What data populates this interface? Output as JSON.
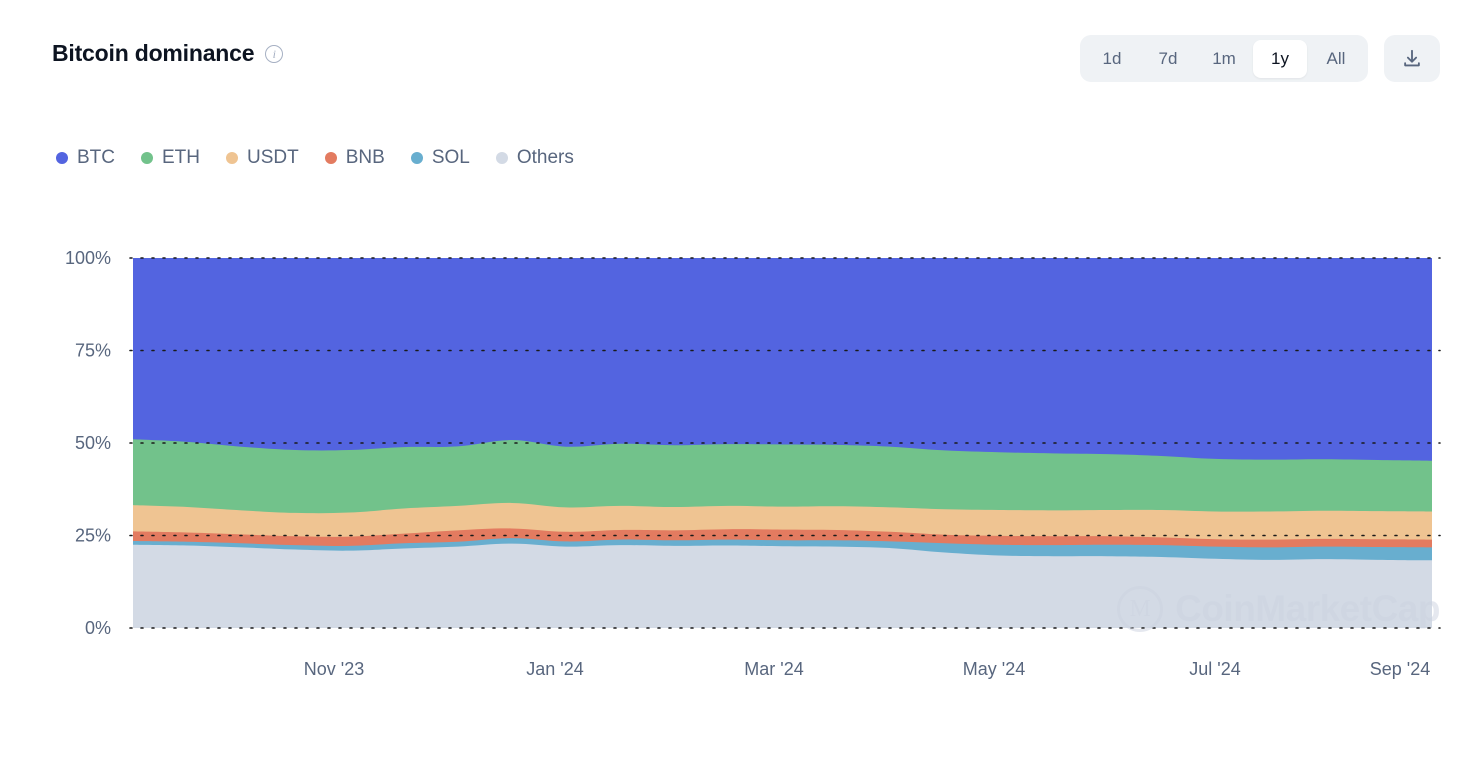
{
  "header": {
    "title": "Bitcoin dominance",
    "info_icon": "info-icon",
    "download_icon": "download-icon"
  },
  "range_selector": {
    "options": [
      "1d",
      "7d",
      "1m",
      "1y",
      "All"
    ],
    "selected": "1y"
  },
  "watermark": {
    "text": "CoinMarketCap",
    "mark": "M"
  },
  "chart_data": {
    "type": "area",
    "stacked": true,
    "normalized": true,
    "title": "Bitcoin dominance",
    "xlabel": "",
    "ylabel": "",
    "ylim": [
      0,
      100
    ],
    "grid": true,
    "legend_position": "top-left",
    "ytick_labels": [
      "0%",
      "25%",
      "50%",
      "75%",
      "100%"
    ],
    "ytick_values": [
      0,
      25,
      50,
      75,
      100
    ],
    "xtick_labels": [
      "Nov '23",
      "Jan '24",
      "Mar '24",
      "May '24",
      "Jul '24",
      "Sep '24"
    ],
    "colors": {
      "BTC": "#5364e0",
      "ETH": "#72c28b",
      "USDT": "#efc492",
      "BNB": "#e37b60",
      "SOL": "#68aecf",
      "Others": "#d3dae5"
    },
    "x": [
      "Sep '23",
      "Oct '23",
      "Oct '23",
      "Nov '23",
      "Nov '23",
      "Dec '23",
      "Dec '23",
      "Jan '24",
      "Jan '24",
      "Feb '24",
      "Feb '24",
      "Mar '24",
      "Mar '24",
      "Apr '24",
      "Apr '24",
      "May '24",
      "May '24",
      "Jun '24",
      "Jun '24",
      "Jul '24",
      "Jul '24",
      "Aug '24",
      "Aug '24",
      "Sep '24",
      "Sep '24"
    ],
    "series": [
      {
        "name": "Others",
        "values": [
          22.5,
          22.3,
          21.8,
          21.2,
          20.9,
          21.5,
          22.0,
          22.8,
          22.0,
          22.4,
          22.2,
          22.3,
          22.1,
          22.0,
          21.6,
          20.4,
          19.6,
          19.4,
          19.4,
          19.2,
          18.7,
          18.4,
          18.6,
          18.4,
          18.3
        ]
      },
      {
        "name": "SOL",
        "values": [
          1.0,
          1.0,
          1.1,
          1.2,
          1.3,
          1.4,
          1.3,
          1.5,
          1.4,
          1.5,
          1.5,
          1.6,
          1.6,
          1.7,
          1.8,
          2.5,
          2.9,
          3.0,
          3.1,
          3.2,
          3.3,
          3.4,
          3.4,
          3.5,
          3.5
        ]
      },
      {
        "name": "BNB",
        "values": [
          2.6,
          2.5,
          2.4,
          2.4,
          2.5,
          2.6,
          3.1,
          2.6,
          2.6,
          2.6,
          2.7,
          2.8,
          2.9,
          2.8,
          2.6,
          2.3,
          2.4,
          2.4,
          2.3,
          2.1,
          2.0,
          2.1,
          2.1,
          2.1,
          2.1
        ]
      },
      {
        "name": "USDT",
        "values": [
          7.1,
          6.9,
          6.5,
          6.3,
          6.5,
          6.8,
          6.6,
          6.9,
          6.6,
          6.5,
          6.3,
          6.3,
          6.2,
          6.4,
          6.6,
          6.9,
          7.0,
          7.0,
          7.1,
          7.4,
          7.5,
          7.6,
          7.6,
          7.6,
          7.6
        ]
      },
      {
        "name": "ETH",
        "values": [
          17.8,
          17.6,
          17.2,
          17.0,
          16.9,
          16.6,
          16.1,
          17.0,
          16.4,
          16.8,
          16.7,
          16.7,
          16.8,
          16.6,
          16.4,
          15.9,
          15.6,
          15.4,
          15.1,
          14.6,
          14.2,
          14.0,
          13.9,
          13.8,
          13.7
        ]
      },
      {
        "name": "BTC",
        "values": [
          49.0,
          49.7,
          51.0,
          51.9,
          51.9,
          51.1,
          50.9,
          49.2,
          51.0,
          50.2,
          50.6,
          50.3,
          50.4,
          50.5,
          51.0,
          52.0,
          52.5,
          52.8,
          53.0,
          53.5,
          54.3,
          54.5,
          54.4,
          54.6,
          54.8
        ]
      }
    ]
  }
}
